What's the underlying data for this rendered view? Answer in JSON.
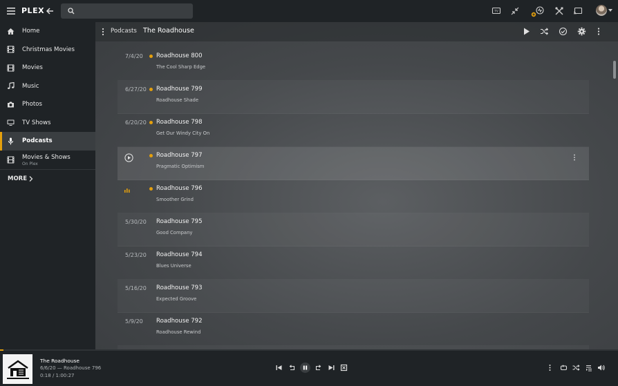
{
  "app": {
    "logo_text": "PLEX",
    "colors": {
      "accent": "#e5a00d",
      "background": "#1f2326",
      "panel": "#3a3e41"
    }
  },
  "topbar": {
    "search": {
      "placeholder": "",
      "value": ""
    },
    "icons": [
      "hamburger-icon",
      "back-arrow-icon",
      "search-icon",
      "tv-icon",
      "minimize-icon",
      "activity-icon",
      "settings-tools-icon",
      "cast-icon",
      "avatar"
    ]
  },
  "sidebar": {
    "items": [
      {
        "label": "Home",
        "icon": "home-icon"
      },
      {
        "label": "Christmas Movies",
        "icon": "film-icon"
      },
      {
        "label": "Movies",
        "icon": "film-icon"
      },
      {
        "label": "Music",
        "icon": "music-note-icon"
      },
      {
        "label": "Photos",
        "icon": "camera-icon"
      },
      {
        "label": "TV Shows",
        "icon": "monitor-icon"
      },
      {
        "label": "Podcasts",
        "icon": "microphone-icon",
        "active": true
      },
      {
        "label": "Movies & Shows",
        "sublabel": "On Plex",
        "icon": "film-icon"
      }
    ],
    "more_label": "MORE"
  },
  "header": {
    "breadcrumb": "Podcasts",
    "title": "The Roadhouse",
    "actions": [
      "play-icon",
      "shuffle-icon",
      "mark-played-icon",
      "settings-gear-icon",
      "more-vertical-icon"
    ]
  },
  "episodes": [
    {
      "date": "7/4/20",
      "title": "Roadhouse 800",
      "subtitle": "The Cool Sharp Edge",
      "unplayed": true,
      "state": "date"
    },
    {
      "date": "6/27/20",
      "title": "Roadhouse 799",
      "subtitle": "Roadhouse Shade",
      "unplayed": true,
      "state": "date"
    },
    {
      "date": "6/20/20",
      "title": "Roadhouse 798",
      "subtitle": "Get Our Windy City On",
      "unplayed": true,
      "state": "date"
    },
    {
      "date": "",
      "title": "Roadhouse 797",
      "subtitle": "Pragmatic Optimism",
      "unplayed": true,
      "state": "hover-play"
    },
    {
      "date": "",
      "title": "Roadhouse 796",
      "subtitle": "Smoother Grind",
      "unplayed": true,
      "state": "now-playing"
    },
    {
      "date": "5/30/20",
      "title": "Roadhouse 795",
      "subtitle": "Good Company",
      "unplayed": false,
      "state": "date"
    },
    {
      "date": "5/23/20",
      "title": "Roadhouse 794",
      "subtitle": "Blues Universe",
      "unplayed": false,
      "state": "date"
    },
    {
      "date": "5/16/20",
      "title": "Roadhouse 793",
      "subtitle": "Expected Groove",
      "unplayed": false,
      "state": "date"
    },
    {
      "date": "5/9/20",
      "title": "Roadhouse 792",
      "subtitle": "Roadhouse Rewind",
      "unplayed": false,
      "state": "date"
    }
  ],
  "player": {
    "title": "The Roadhouse",
    "subtitle": "6/6/20 — Roadhouse 796",
    "time": "0:18 / 1:00:27",
    "progress_fraction": 0.005,
    "controls": [
      "skip-previous-icon",
      "replay-icon",
      "pause-icon",
      "forward-icon",
      "skip-next-icon",
      "stop-icon"
    ],
    "right_controls": [
      "more-vertical-icon",
      "repeat-icon",
      "shuffle-icon",
      "playlist-icon",
      "volume-icon"
    ]
  }
}
